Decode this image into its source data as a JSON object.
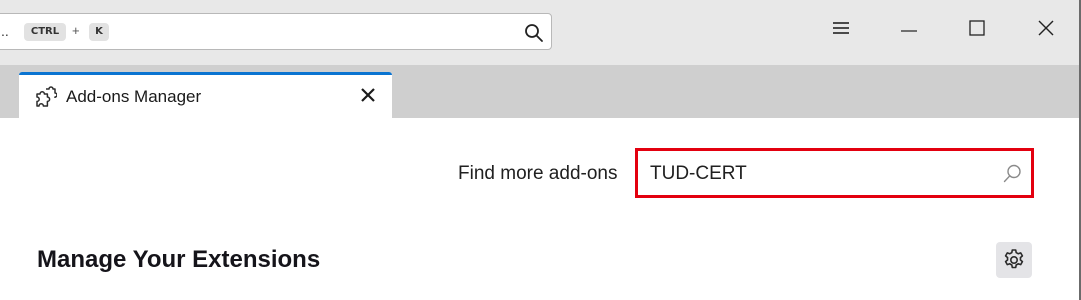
{
  "toolbar": {
    "url_ellipsis": "..",
    "shortcut_ctrl": "CTRL",
    "shortcut_plus": "+",
    "shortcut_key": "K",
    "url_search_icon": "search-icon",
    "menu_icon": "hamburger-menu-icon",
    "minimize_icon": "minimize-icon",
    "maximize_icon": "maximize-icon",
    "close_icon": "close-icon"
  },
  "tabs": [
    {
      "label": "Add-ons Manager",
      "icon": "puzzle-piece-icon",
      "active": true,
      "accent_color": "#0a74d1"
    }
  ],
  "content": {
    "find_label": "Find more add-ons",
    "search_value": "TUD-CERT",
    "search_icon": "search-icon",
    "highlight_color": "#e3000f",
    "heading": "Manage Your Extensions",
    "settings_icon": "gear-icon"
  }
}
